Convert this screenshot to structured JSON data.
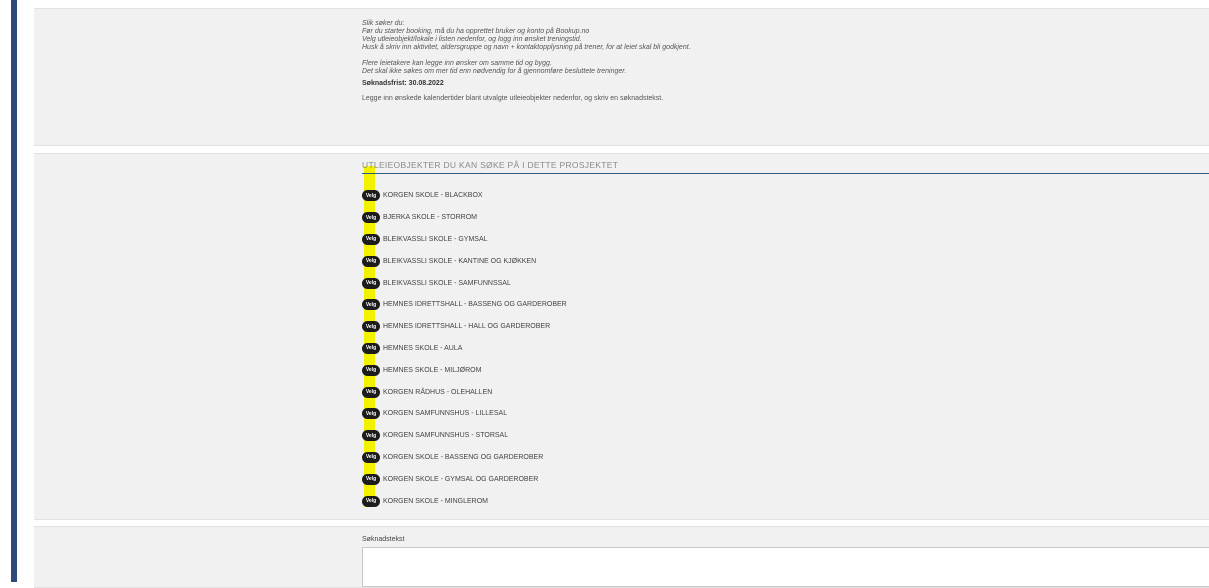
{
  "info": {
    "lines": [
      "Slik søker du:",
      "Før du starter booking, må du ha opprettet bruker og konto på Bookup.no",
      "Velg utleieobjekt/lokale i listen nedenfor, og logg inn ønsket treningstid.",
      "Husk å skriv inn aktivitet, aldersgruppe og navn + kontaktopplysning på trener, for at leiet skal bli godkjent."
    ],
    "lines2": [
      "Flere leietakere kan legge inn ønsker om samme tid og bygg.",
      "Det skal ikke søkes om mer tid enn nødvendig for å gjennomføre besluttete treninger."
    ],
    "deadline": "Søknadsfrist: 30.08.2022",
    "lead": "Legge inn ønskede kalendertider blant utvalgte utleieobjekter nedenfor, og skriv en søknadstekst."
  },
  "objects": {
    "heading": "UTLEIEOBJEKTER DU KAN SØKE PÅ I DETTE PROSJEKTET",
    "select_label": "Velg",
    "items": [
      "KORGEN SKOLE - BLACKBOX",
      "BJERKA SKOLE - STORROM",
      "BLEIKVASSLI SKOLE - GYMSAL",
      "BLEIKVASSLI SKOLE - KANTINE OG KJØKKEN",
      "BLEIKVASSLI SKOLE - SAMFUNNSSAL",
      "HEMNES IDRETTSHALL - BASSENG OG GARDEROBER",
      "HEMNES IDRETTSHALL - HALL OG GARDEROBER",
      "HEMNES SKOLE - AULA",
      "HEMNES SKOLE - MILJØROM",
      "KORGEN RÅDHUS - OLEHALLEN",
      "KORGEN SAMFUNNSHUS - LILLESAL",
      "KORGEN SAMFUNNSHUS - STORSAL",
      "KORGEN SKOLE - BASSENG OG GARDEROBER",
      "KORGEN SKOLE - GYMSAL OG GARDEROBER",
      "KORGEN SKOLE - MINGLEROM"
    ]
  },
  "application": {
    "label": "Søknadstekst",
    "value": ""
  },
  "colors": {
    "highlight": "#f2f200",
    "select_badge": "#1c1c1c",
    "sidebar_accent": "#2e4a78"
  }
}
